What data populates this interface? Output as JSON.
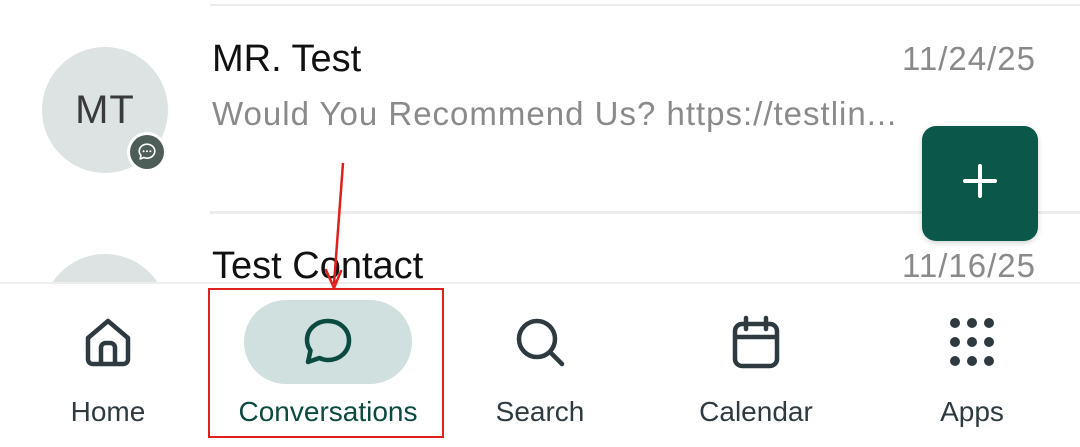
{
  "conversations": [
    {
      "initials": "MT",
      "name": "MR. Test",
      "date": "11/24/25",
      "preview": "Would You Recommend Us? https://testlin...",
      "channel_icon": "chat-bubble-icon"
    },
    {
      "initials": "",
      "name": "Test Contact",
      "date": "11/16/25"
    }
  ],
  "fab": {
    "icon": "plus-icon"
  },
  "bottom_nav": {
    "active": "Conversations",
    "items": [
      {
        "label": "Home",
        "icon": "home-icon"
      },
      {
        "label": "Conversations",
        "icon": "chat-bubble-icon"
      },
      {
        "label": "Search",
        "icon": "search-icon"
      },
      {
        "label": "Calendar",
        "icon": "calendar-icon"
      },
      {
        "label": "Apps",
        "icon": "apps-grid-icon"
      }
    ]
  },
  "colors": {
    "brand": "#0b574a",
    "active_pill": "#cfe0de",
    "avatar_bg": "#dce3e2",
    "annotation": "#e0201b"
  }
}
